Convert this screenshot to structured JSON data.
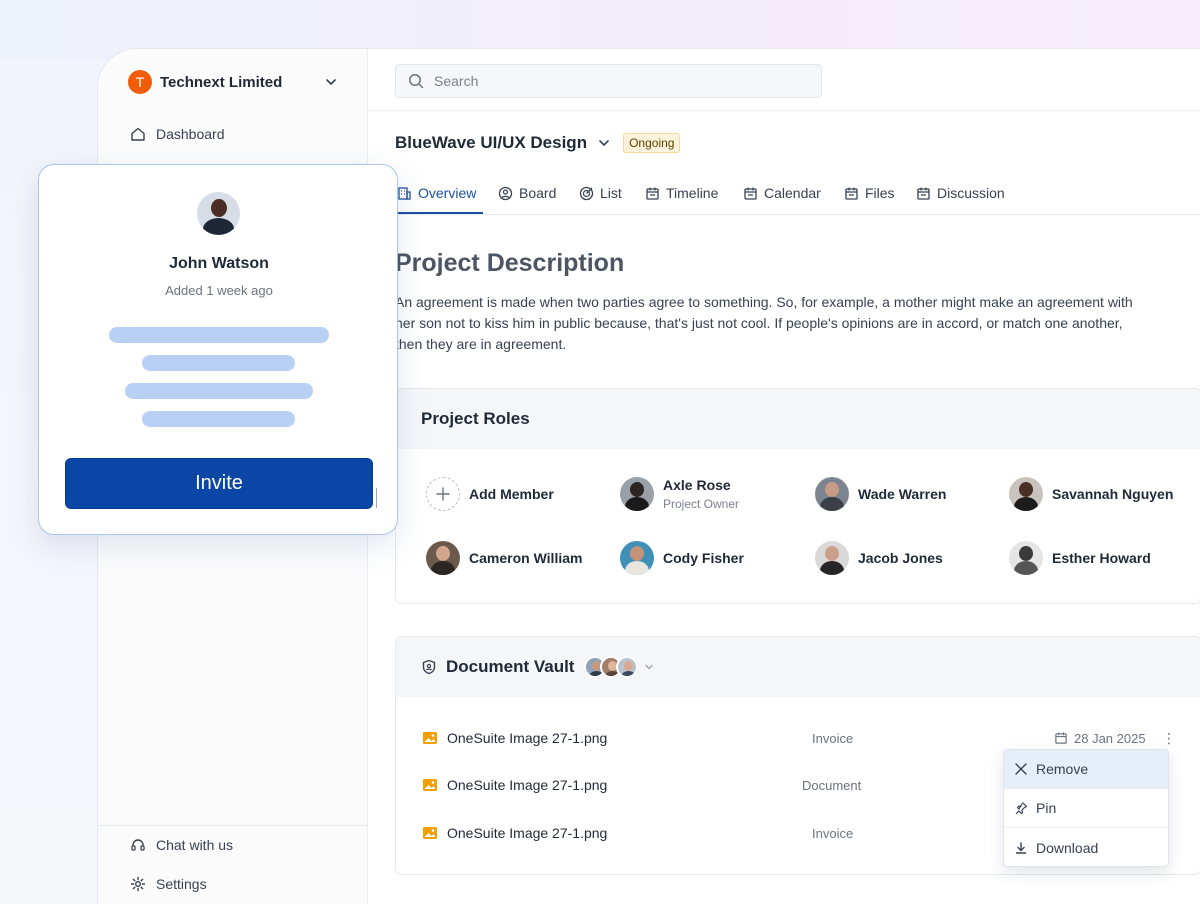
{
  "org": {
    "initial": "T",
    "name": "Technext Limited"
  },
  "sidebar": {
    "top_items": [
      {
        "label": "Dashboard",
        "icon": "home-icon"
      }
    ],
    "bottom_items": [
      {
        "label": "Chat with us",
        "icon": "headset-icon"
      },
      {
        "label": "Settings",
        "icon": "gear-icon"
      }
    ]
  },
  "search": {
    "placeholder": "Search"
  },
  "project": {
    "title": "BlueWave UI/UX Design",
    "status": "Ongoing",
    "tabs": [
      {
        "label": "Overview",
        "icon": "building-icon",
        "active": true
      },
      {
        "label": "Board",
        "icon": "user-circle-icon"
      },
      {
        "label": "List",
        "icon": "target-icon"
      },
      {
        "label": "Timeline",
        "icon": "calendar-icon"
      },
      {
        "label": "Calendar",
        "icon": "calendar-icon"
      },
      {
        "label": "Files",
        "icon": "calendar-icon"
      },
      {
        "label": "Discussion",
        "icon": "calendar-icon"
      }
    ],
    "description_title": "Project Description",
    "description": "An agreement is made when two parties agree to something. So, for example, a mother might make an agreement with her son not to kiss him in public because, that's just not cool. If people's opinions are in accord, or match one another, then they are in agreement."
  },
  "roles": {
    "title": "Project Roles",
    "add_label": "Add Member",
    "members": [
      {
        "name": "Axle Rose",
        "role": "Project Owner"
      },
      {
        "name": "Wade Warren"
      },
      {
        "name": "Savannah Nguyen"
      },
      {
        "name": "Cameron William"
      },
      {
        "name": "Cody Fisher"
      },
      {
        "name": "Jacob Jones"
      },
      {
        "name": "Esther Howard"
      }
    ]
  },
  "vault": {
    "title": "Document Vault",
    "documents": [
      {
        "name": "OneSuite Image 27-1.png",
        "type": "Invoice",
        "date": "28 Jan 2025"
      },
      {
        "name": "OneSuite Image 27-1.png",
        "type": "Document"
      },
      {
        "name": "OneSuite Image 27-1.png",
        "type": "Invoice"
      }
    ],
    "menu": [
      {
        "label": "Remove",
        "icon": "close-icon",
        "active": true
      },
      {
        "label": "Pin",
        "icon": "pin-icon"
      },
      {
        "label": "Download",
        "icon": "download-icon"
      }
    ]
  },
  "popover": {
    "name": "John Watson",
    "subtitle": "Added 1 week ago",
    "button": "Invite"
  },
  "colors": {
    "primary": "#0a46a5",
    "accent_tab": "#1d4fa3",
    "org_logo": "#f25c05",
    "badge_bg": "#fdf3dc",
    "skeleton": "#b8d0f4"
  }
}
